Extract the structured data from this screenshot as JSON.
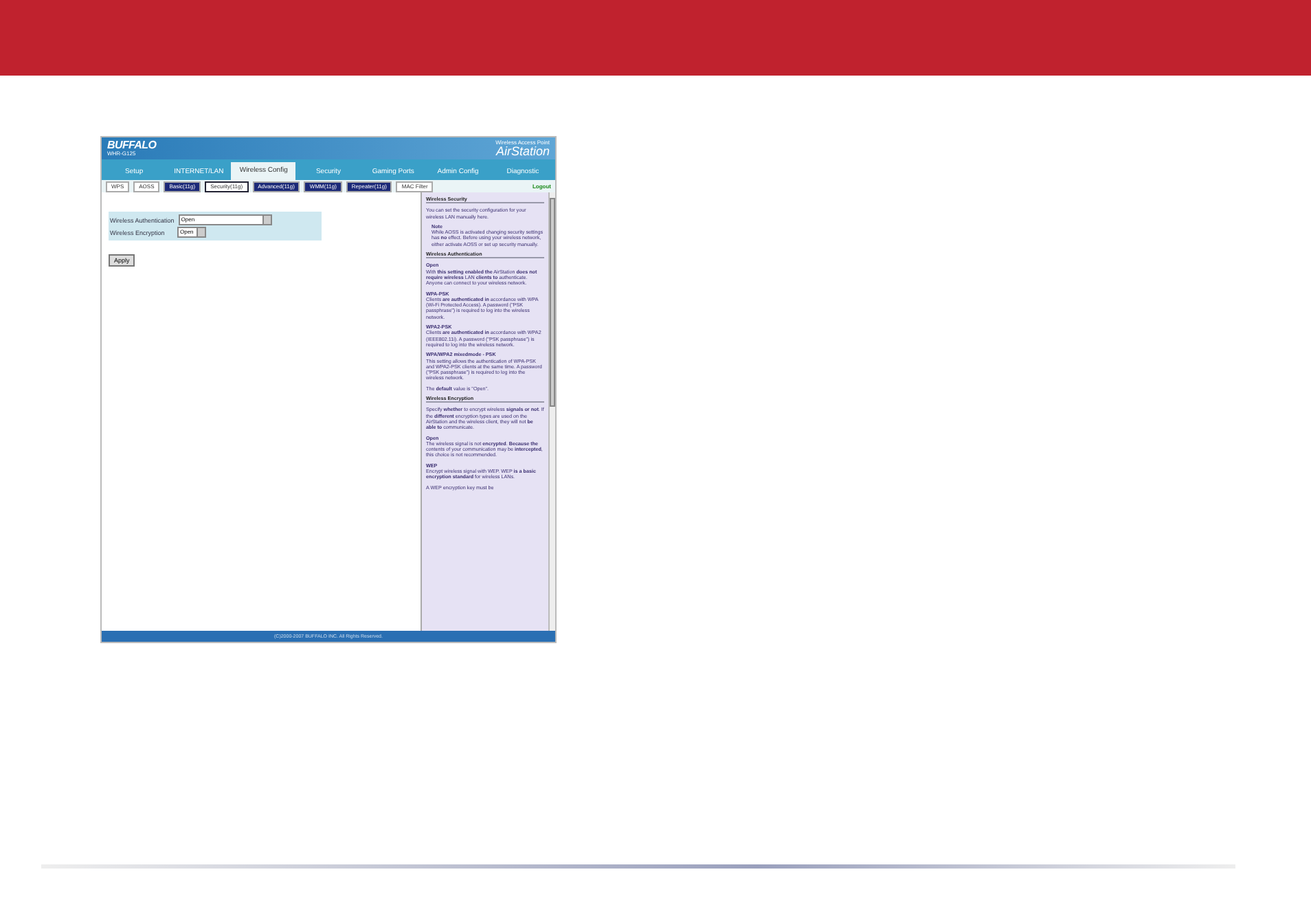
{
  "router": {
    "logo": "BUFFALO",
    "model": "WHR-G125",
    "product_line": "Wireless Access Point",
    "product": "AirStation",
    "tabs": [
      {
        "label": "Setup",
        "selected": false
      },
      {
        "label": "INTERNET/LAN",
        "selected": false
      },
      {
        "label": "Wireless Config",
        "selected": true
      },
      {
        "label": "Security",
        "selected": false
      },
      {
        "label": "Gaming Ports",
        "selected": false
      },
      {
        "label": "Admin Config",
        "selected": false
      },
      {
        "label": "Diagnostic",
        "selected": false
      }
    ],
    "subtabs": [
      {
        "label": "WPS",
        "kind": "plain",
        "selected": false
      },
      {
        "label": "AOSS",
        "kind": "plain",
        "selected": false
      },
      {
        "label": "Basic(11g)",
        "kind": "dark",
        "selected": false
      },
      {
        "label": "Security(11g)",
        "kind": "dark",
        "selected": true
      },
      {
        "label": "Advanced(11g)",
        "kind": "dark",
        "selected": false
      },
      {
        "label": "WMM(11g)",
        "kind": "dark",
        "selected": false
      },
      {
        "label": "Repeater(11g)",
        "kind": "dark",
        "selected": false
      },
      {
        "label": "MAC Filter",
        "kind": "plain",
        "selected": false
      }
    ],
    "logout": "Logout",
    "form": [
      {
        "label": "Wireless Authentication",
        "value": "Open",
        "kind": "long"
      },
      {
        "label": "Wireless Encryption",
        "value": "Open",
        "kind": "short"
      }
    ],
    "apply_button": "Apply",
    "help": [
      {
        "kind": "heading",
        "text": "Wireless Security"
      },
      {
        "kind": "text",
        "text": "You can set the security configuration for your wireless LAN manually here."
      },
      {
        "kind": "note",
        "text": "Note"
      },
      {
        "kind": "note_text",
        "text": "While AOSS is activated changing security settings has **no** effect. Before using your wireless network, either activate AOSS or set up security manually."
      },
      {
        "kind": "heading",
        "text": "Wireless Authentication"
      },
      {
        "kind": "subheading",
        "text": "Open"
      },
      {
        "kind": "text",
        "text": "With **this setting enabled the** AirStation **does not require wireless** LAN **clients to** authenticate. Anyone can connect to your wireless network."
      },
      {
        "kind": "subheading",
        "text": "WPA-PSK"
      },
      {
        "kind": "text",
        "text": "Clients **are authenticated in** accordance with WPA (Wi-Fi Protected Access). A password (\"PSK passphrase\") is required to log into the wireless network."
      },
      {
        "kind": "subheading",
        "text": "WPA2-PSK"
      },
      {
        "kind": "text",
        "text": "Clients **are authenticated in** accordance with WPA2 (IEEE802.11i). A password (\"PSK passphrase\") is required to log into the wireless network."
      },
      {
        "kind": "subheading",
        "text": "WPA/WPA2 mixedmode - PSK"
      },
      {
        "kind": "text",
        "text": "This setting allows the authentication of WPA-PSK and WPA2-PSK clients at the same time. A password (\"PSK passphrase\") is required to log into the wireless network."
      },
      {
        "kind": "text",
        "text": "The **default** value is \"Open\"."
      },
      {
        "kind": "heading",
        "text": "Wireless Encryption"
      },
      {
        "kind": "text",
        "text": "Specify **whether** to encrypt wireless **signals or not**. If the **different** encryption types are used on the AirStation and the wireless client, they will not **be able to** communicate."
      },
      {
        "kind": "subheading",
        "text": "Open"
      },
      {
        "kind": "text",
        "text": "The wireless signal is not **encrypted**. **Because the** contents of your communication may be **intercepted**, this choice is not recommended."
      },
      {
        "kind": "subheading",
        "text": "WEP"
      },
      {
        "kind": "text",
        "text": "Encrypt wireless signal with WEP. WEP **is a basic encryption standard** for wireless LANs."
      },
      {
        "kind": "text",
        "text": "A WEP encryption key must be"
      }
    ],
    "copyright": "(C)2000-2007 BUFFALO INC. All Rights Reserved."
  }
}
